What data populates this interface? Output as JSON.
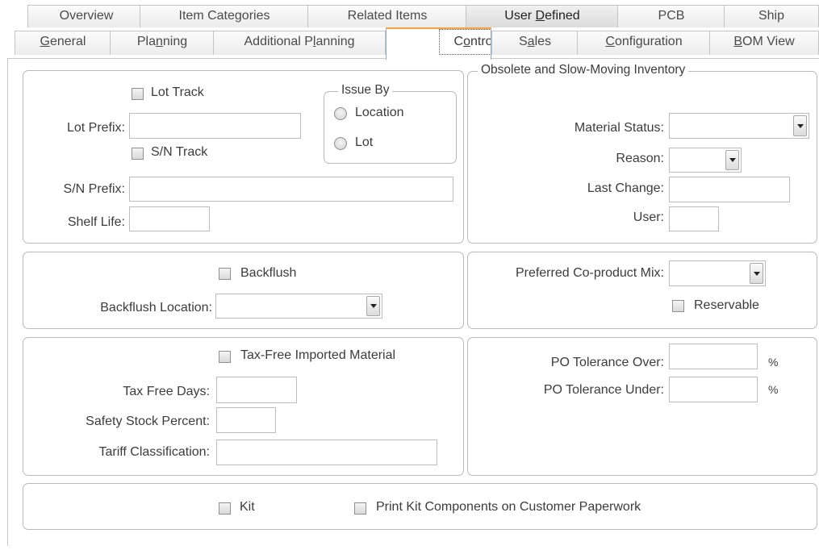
{
  "tabs": {
    "row1": [
      "Overview",
      "Item Categories",
      "Related Items",
      "User Defined",
      "PCB",
      "Ship"
    ],
    "row2": [
      "General",
      "Planning",
      "Additional Planning",
      "Controls",
      "Sales",
      "Configuration",
      "BOM View"
    ]
  },
  "lot_section": {
    "lot_track_label": "Lot Track",
    "lot_prefix_label": "Lot Prefix:",
    "lot_prefix_value": "",
    "sn_track_label": "S/N Track",
    "sn_prefix_label": "S/N Prefix:",
    "sn_prefix_value": "",
    "shelf_life_label": "Shelf Life:",
    "shelf_life_value": "",
    "issue_by": {
      "legend": "Issue By",
      "location_label": "Location",
      "lot_label": "Lot"
    }
  },
  "obsolete_section": {
    "legend": "Obsolete and Slow-Moving Inventory",
    "material_status_label": "Material Status:",
    "material_status_value": "",
    "reason_label": "Reason:",
    "reason_value": "",
    "last_change_label": "Last Change:",
    "last_change_value": "",
    "user_label": "User:",
    "user_value": ""
  },
  "backflush_section": {
    "backflush_label": "Backflush",
    "location_label": "Backflush Location:",
    "location_value": ""
  },
  "coproduct_section": {
    "mix_label": "Preferred Co-product Mix:",
    "mix_value": "",
    "reservable_label": "Reservable"
  },
  "tax_section": {
    "tax_free_label": "Tax-Free Imported Material",
    "tax_free_days_label": "Tax Free Days:",
    "safety_stock_label": "Safety Stock Percent:",
    "tariff_label": "Tariff Classification:"
  },
  "po_section": {
    "over_label": "PO Tolerance Over:",
    "under_label": "PO Tolerance Under:",
    "percent": "%"
  },
  "kit_section": {
    "kit_label": "Kit",
    "print_label": "Print Kit Components on Customer Paperwork"
  }
}
